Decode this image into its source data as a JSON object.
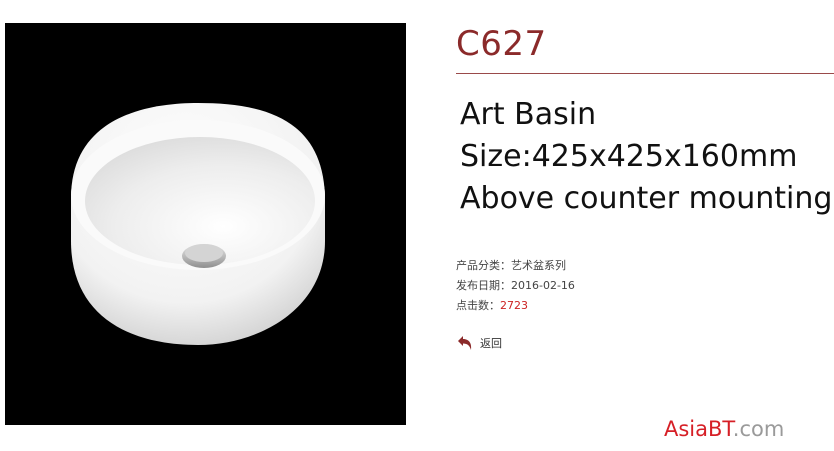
{
  "product": {
    "code": "C627",
    "specs": [
      "Art Basin",
      "Size:425x425x160mm",
      "Above counter mounting"
    ],
    "meta": {
      "category_label": "产品分类：",
      "category_value": "艺术盆系列",
      "date_label": "发布日期：",
      "date_value": "2016-02-16",
      "views_label": "点击数：",
      "views_value": "2723"
    },
    "back_label": "返回"
  },
  "watermark": {
    "brand": "AsiaBT",
    "tld": ".com"
  },
  "colors": {
    "code": "#8b2a2a",
    "views": "#cc2222",
    "watermark_brand": "#d61f26",
    "photo_background": "#000000"
  },
  "icons": {
    "back": "return-arrow-icon"
  }
}
